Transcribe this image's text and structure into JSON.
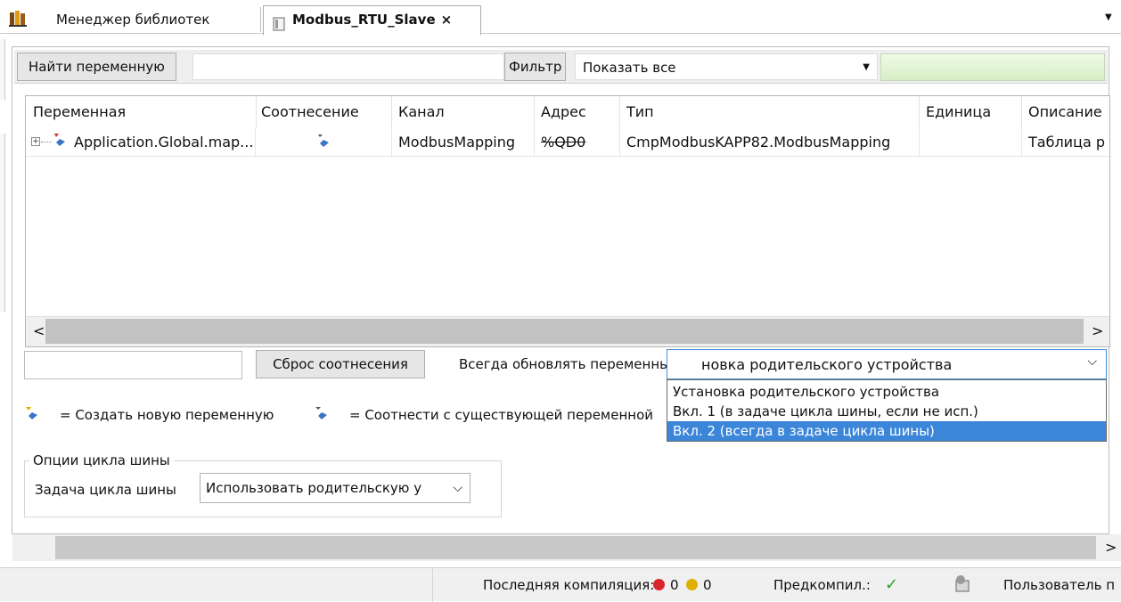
{
  "tabs": [
    {
      "label": "Менеджер библиотек"
    },
    {
      "label": "Modbus_RTU_Slave",
      "close": "×"
    }
  ],
  "toolbar": {
    "find_label": "Найти переменную",
    "filter_label": "Фильтр",
    "filter_value": "Показать все"
  },
  "table": {
    "columns": [
      "Переменная",
      "Соотнесение",
      "Канал",
      "Адрес",
      "Тип",
      "Единица",
      "Описание"
    ],
    "rows": [
      {
        "variable": "Application.Global.map...",
        "channel": "ModbusMapping",
        "address": "%QD0",
        "type": "CmpModbusKAPP82.ModbusMapping",
        "unit": "",
        "description": "Таблица р"
      }
    ],
    "scroll_left": "<",
    "scroll_right": ">"
  },
  "controls": {
    "reset_button": "Сброс соотнесения",
    "update_label": "Всегда обновлять переменные:",
    "update_value": "новка родительского устройства",
    "options": [
      "Установка родительского устройства",
      "Вкл. 1 (в задаче цикла шины, если не исп.)",
      "Вкл. 2 (всегда в задаче цикла шины)"
    ],
    "selected_index": 2
  },
  "legend": {
    "create": "= Создать новую переменную",
    "map": "= Соотнести с существующей переменной"
  },
  "bus_cycle": {
    "group_title": "Опции цикла шины",
    "task_label": "Задача цикла шины",
    "task_value": "Использовать родительскую у"
  },
  "statusbar": {
    "last_compile_label": "Последняя компиляция:",
    "errors": "0",
    "warnings": "0",
    "precompile_label": "Предкомпил.:",
    "precompile_check": "✓",
    "user_label": "Пользователь п"
  },
  "colors": {
    "accent": "#3b86d9",
    "error": "#d9262a",
    "warning": "#e0b000",
    "ok": "#2e9e2e"
  }
}
